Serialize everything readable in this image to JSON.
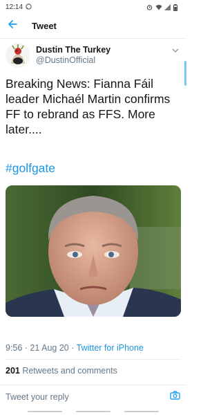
{
  "status": {
    "time": "12:14",
    "left_icon": "whatsapp-icon",
    "right_icons": [
      "alarm-icon",
      "wifi-icon",
      "signal-icon",
      "battery-icon"
    ]
  },
  "header": {
    "back_icon": "back-arrow-icon",
    "title": "Tweet"
  },
  "tweet": {
    "display_name": "Dustin The Turkey",
    "handle": "@DustinOfficial",
    "text": "Breaking News: Fianna Fáil leader Michaél Martin confirms FF to rebrand as FFS. More later....",
    "hashtag": "#golfgate",
    "time_date": "9:56 · 21 Aug 20 · ",
    "source": "Twitter for iPhone",
    "retweet_count": "201",
    "retweet_label": " Retweets and comments"
  },
  "reply": {
    "placeholder": "Tweet your reply",
    "camera_icon": "camera-icon"
  },
  "colors": {
    "accent": "#1da1f2",
    "link": "#1b95e0",
    "secondary_text": "#657786"
  }
}
